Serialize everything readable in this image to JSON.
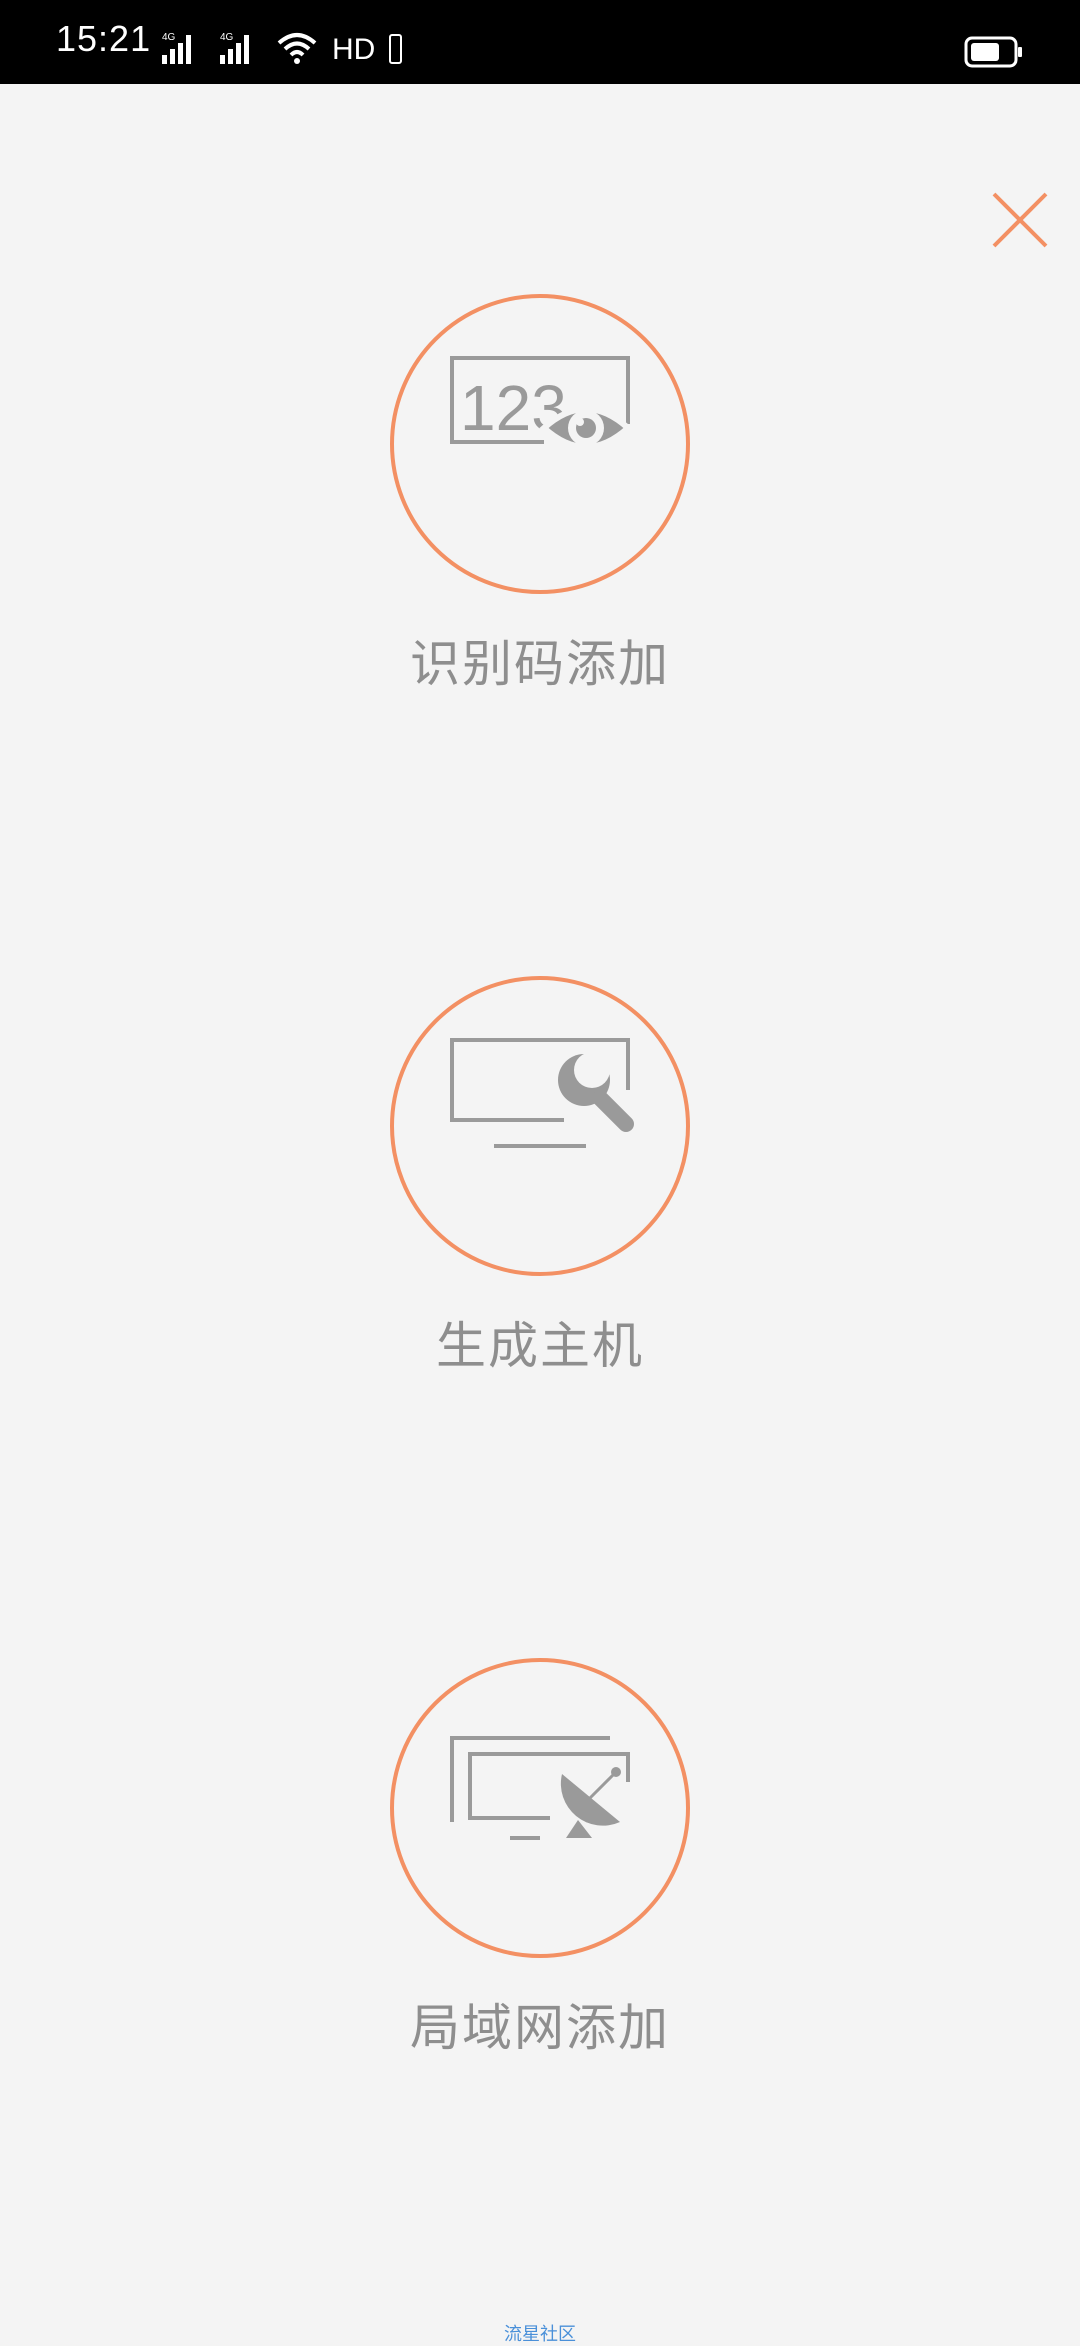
{
  "status_bar": {
    "time": "15:21",
    "network_label": "HD",
    "icons": [
      "signal-4g-icon",
      "signal-4g-icon",
      "wifi-icon",
      "battery-icon"
    ]
  },
  "close": {
    "icon": "close-icon",
    "color": "#f39063"
  },
  "options": [
    {
      "icon": "id-code-eye-icon",
      "label": "识别码添加"
    },
    {
      "icon": "monitor-search-icon",
      "label": "生成主机"
    },
    {
      "icon": "lan-satellite-icon",
      "label": "局域网添加"
    }
  ],
  "footer": {
    "watermark": "流星社区"
  },
  "colors": {
    "accent": "#f39063",
    "icon_gray": "#9a9a9a",
    "label_gray": "#8e8e8e",
    "background": "#f4f4f4"
  }
}
